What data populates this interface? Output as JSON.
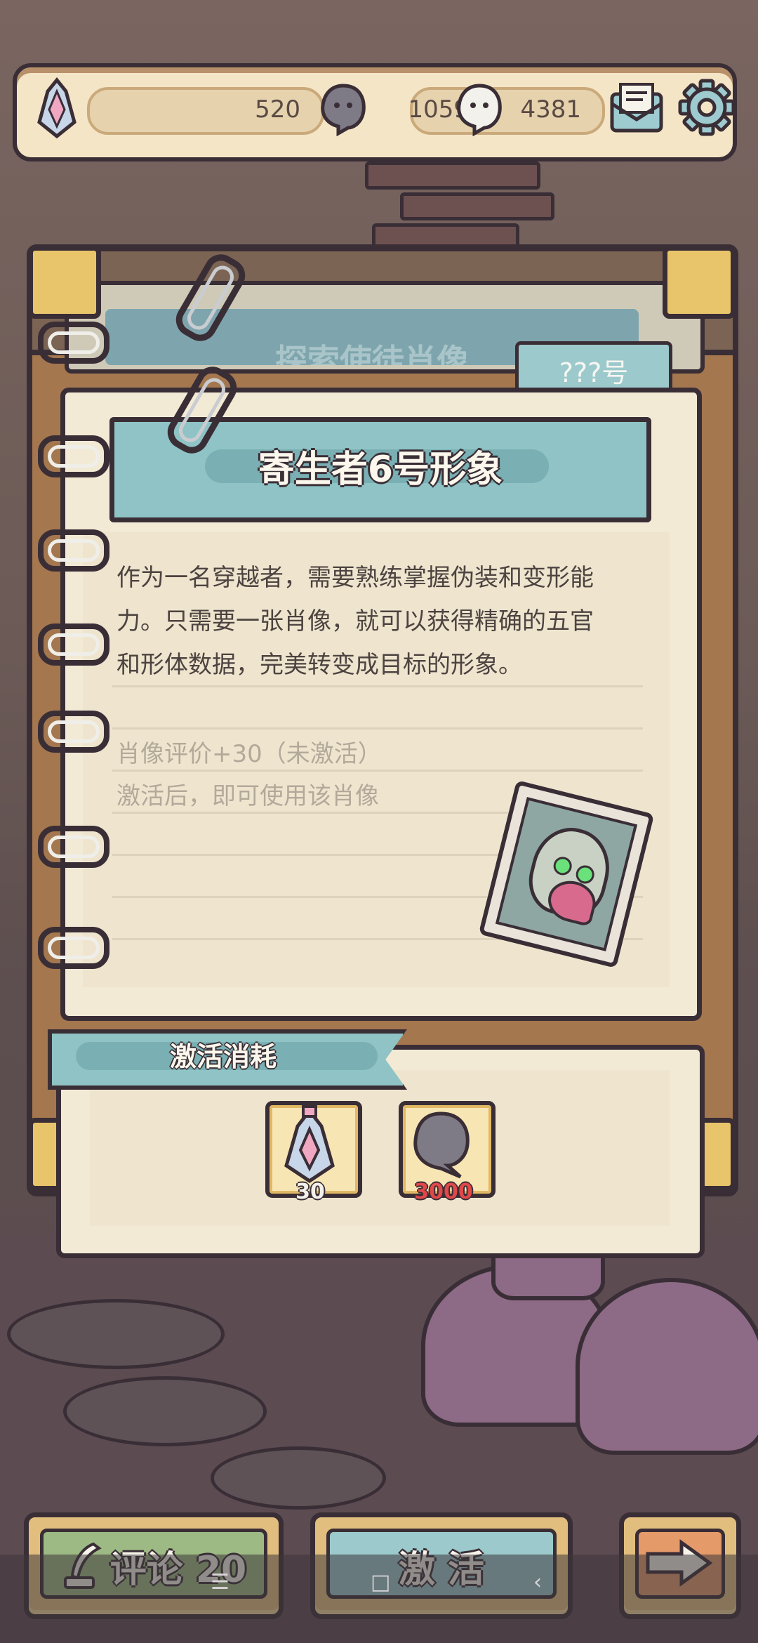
{
  "resources": {
    "potion_count": "520",
    "ghost_count": "1059",
    "chat_count": "4381"
  },
  "header_icons": {
    "mail": "mail-icon",
    "settings": "gear-icon"
  },
  "back_page_title": "探索使徒肖像",
  "tab_label": "???号",
  "card": {
    "title": "寄生者6号形象",
    "description_lines": [
      "作为一名穿越者，需要熟练掌握伪装和变形能",
      "力。只需要一张肖像，就可以获得精确的五官",
      "和形体数据，完美转变成目标的形象。"
    ],
    "bonus": "肖像评价+30（未激活）",
    "activation_hint": "激活后，即可使用该肖像"
  },
  "cost": {
    "title": "激活消耗",
    "items": [
      {
        "icon": "potion-icon",
        "amount": "30",
        "amount_color": "#f2f0ea"
      },
      {
        "icon": "ghost-icon",
        "amount": "3000",
        "amount_color": "#e0484a"
      }
    ]
  },
  "buttons": {
    "comment_label": "评论 20",
    "activate_label": "激 活",
    "next_icon": "arrow-right-icon"
  },
  "colors": {
    "comment_button": "#9dba84",
    "activate_button": "#9cc9cc",
    "next_button": "#e59a6a",
    "banner": "#8fc3c5"
  }
}
